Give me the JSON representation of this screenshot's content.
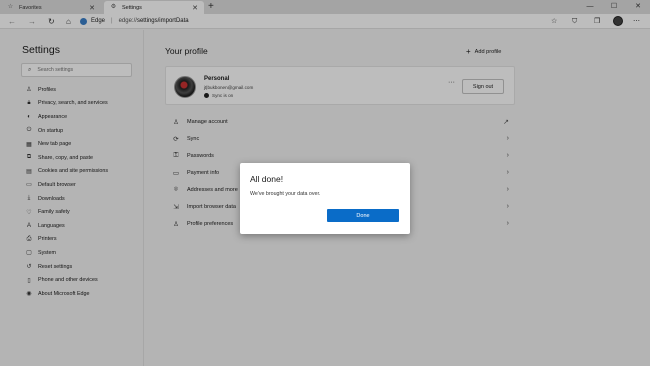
{
  "browser": {
    "tabs": [
      {
        "label": "Favorites",
        "icon": "star-icon",
        "active": false
      },
      {
        "label": "Settings",
        "icon": "gear-icon",
        "active": true
      }
    ],
    "new_tab": "+",
    "address": {
      "site_label": "Edge",
      "url_prefix": "edge://",
      "url_path": "settings/importData"
    }
  },
  "sidebar": {
    "title": "Settings",
    "search_placeholder": "Search settings",
    "items": [
      {
        "label": "Profiles",
        "icon": "person-icon"
      },
      {
        "label": "Privacy, search, and services",
        "icon": "lock-icon"
      },
      {
        "label": "Appearance",
        "icon": "appearance-icon"
      },
      {
        "label": "On startup",
        "icon": "power-icon"
      },
      {
        "label": "New tab page",
        "icon": "newtab-icon"
      },
      {
        "label": "Share, copy, and paste",
        "icon": "share-icon"
      },
      {
        "label": "Cookies and site permissions",
        "icon": "cookie-icon"
      },
      {
        "label": "Default browser",
        "icon": "browser-icon"
      },
      {
        "label": "Downloads",
        "icon": "download-icon"
      },
      {
        "label": "Family safety",
        "icon": "family-icon"
      },
      {
        "label": "Languages",
        "icon": "language-icon"
      },
      {
        "label": "Printers",
        "icon": "printer-icon"
      },
      {
        "label": "System",
        "icon": "system-icon"
      },
      {
        "label": "Reset settings",
        "icon": "reset-icon"
      },
      {
        "label": "Phone and other devices",
        "icon": "phone-icon"
      },
      {
        "label": "About Microsoft Edge",
        "icon": "edge-icon"
      }
    ]
  },
  "main": {
    "title": "Your profile",
    "add_profile": "Add profile",
    "profile": {
      "name": "Personal",
      "email": "jt|bukbonen@gmail.com",
      "sync_status": "Sync is on",
      "more": "···",
      "sign_out": "Sign out"
    },
    "rows": [
      {
        "label": "Manage account",
        "icon": "person-icon",
        "trail": "external-link-icon"
      },
      {
        "label": "Sync",
        "icon": "sync-icon",
        "trail": "chevron-right-icon"
      },
      {
        "label": "Passwords",
        "icon": "key-icon",
        "trail": "chevron-right-icon"
      },
      {
        "label": "Payment info",
        "icon": "card-icon",
        "trail": "chevron-right-icon"
      },
      {
        "label": "Addresses and more",
        "icon": "location-icon",
        "trail": "chevron-right-icon"
      },
      {
        "label": "Import browser data",
        "icon": "import-icon",
        "trail": "chevron-right-icon"
      },
      {
        "label": "Profile preferences",
        "icon": "profile-prefs-icon",
        "trail": "chevron-right-icon"
      }
    ]
  },
  "dialog": {
    "title": "All done!",
    "message": "We've brought your data over.",
    "button": "Done"
  },
  "colors": {
    "accent": "#0a6cc8",
    "overlay": "rgba(0,0,0,0.26)"
  }
}
